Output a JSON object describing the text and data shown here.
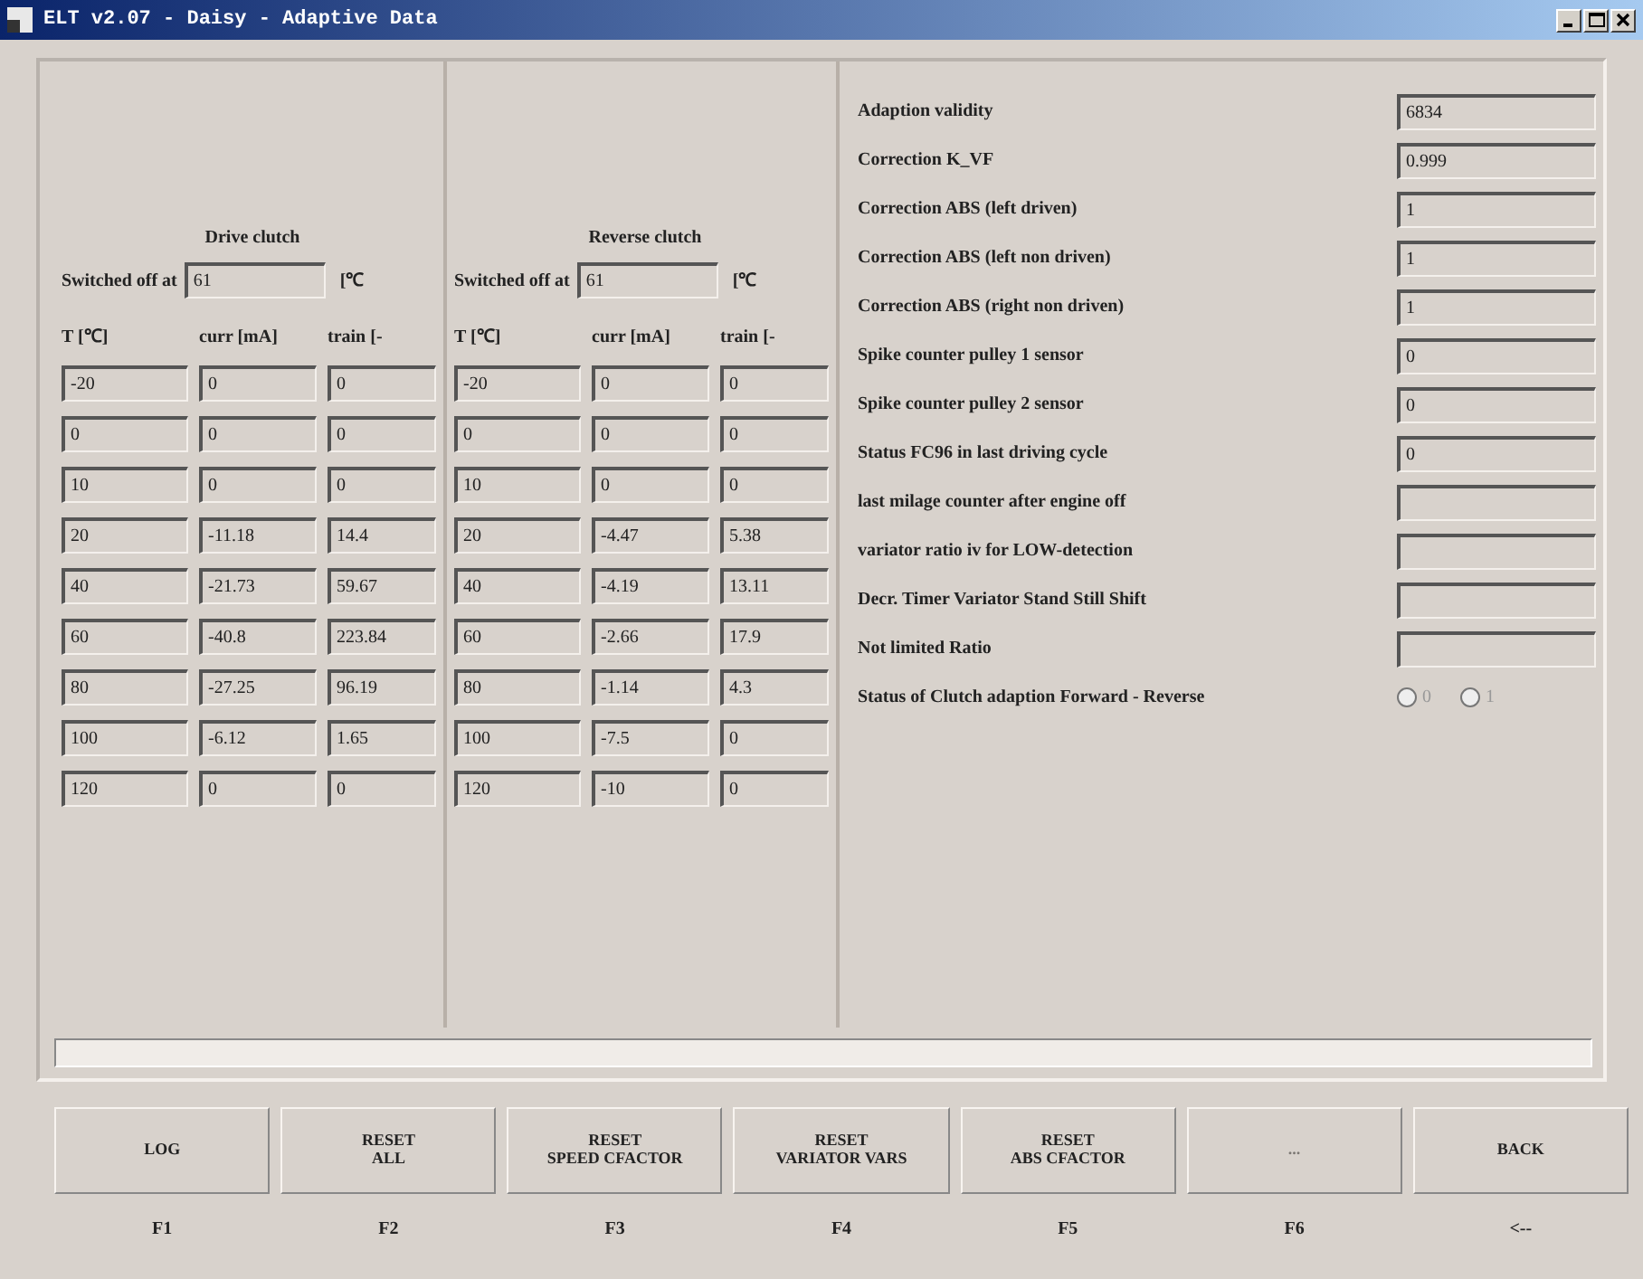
{
  "window": {
    "title": "ELT v2.07 - Daisy - Adaptive Data"
  },
  "clutches": [
    {
      "title": "Drive clutch",
      "switched_label": "Switched off at",
      "switched_value": "61",
      "switched_unit": "[℃",
      "columns": [
        "T [℃]",
        "curr [mA]",
        "train [-"
      ],
      "rows": [
        [
          "-20",
          "0",
          "0"
        ],
        [
          "0",
          "0",
          "0"
        ],
        [
          "10",
          "0",
          "0"
        ],
        [
          "20",
          "-11.18",
          "14.4"
        ],
        [
          "40",
          "-21.73",
          "59.67"
        ],
        [
          "60",
          "-40.8",
          "223.84"
        ],
        [
          "80",
          "-27.25",
          "96.19"
        ],
        [
          "100",
          "-6.12",
          "1.65"
        ],
        [
          "120",
          "0",
          "0"
        ]
      ]
    },
    {
      "title": "Reverse clutch",
      "switched_label": "Switched off at",
      "switched_value": "61",
      "switched_unit": "[℃",
      "columns": [
        "T [℃]",
        "curr [mA]",
        "train [-"
      ],
      "rows": [
        [
          "-20",
          "0",
          "0"
        ],
        [
          "0",
          "0",
          "0"
        ],
        [
          "10",
          "0",
          "0"
        ],
        [
          "20",
          "-4.47",
          "5.38"
        ],
        [
          "40",
          "-4.19",
          "13.11"
        ],
        [
          "60",
          "-2.66",
          "17.9"
        ],
        [
          "80",
          "-1.14",
          "4.3"
        ],
        [
          "100",
          "-7.5",
          "0"
        ],
        [
          "120",
          "-10",
          "0"
        ]
      ]
    }
  ],
  "parameters": [
    {
      "label": "Adaption validity",
      "value": "6834"
    },
    {
      "label": "Correction K_VF",
      "value": "0.999"
    },
    {
      "label": "Correction ABS (left driven)",
      "value": "1"
    },
    {
      "label": "Correction ABS (left non driven)",
      "value": "1"
    },
    {
      "label": "Correction ABS (right non driven)",
      "value": "1"
    },
    {
      "label": "Spike counter pulley 1 sensor",
      "value": "0"
    },
    {
      "label": "Spike counter pulley 2 sensor",
      "value": "0"
    },
    {
      "label": "Status FC96 in last driving cycle",
      "value": "0"
    },
    {
      "label": "last milage counter after engine off"
    },
    {
      "label": "variator ratio iv for LOW-detection"
    },
    {
      "label": "Decr. Timer Variator Stand Still Shift"
    },
    {
      "label": "Not limited Ratio"
    }
  ],
  "clutch_status": {
    "label": "Status of Clutch adaption Forward - Reverse",
    "options": [
      {
        "label": "0",
        "selected": false
      },
      {
        "label": "1",
        "selected": false
      }
    ]
  },
  "buttons": [
    {
      "label": "LOG",
      "key": "F1",
      "disabled": false
    },
    {
      "label": "RESET\nALL",
      "key": "F2",
      "disabled": false
    },
    {
      "label": "RESET\nSPEED CFACTOR",
      "key": "F3",
      "disabled": false
    },
    {
      "label": "RESET\nVARIATOR VARS",
      "key": "F4",
      "disabled": false
    },
    {
      "label": "RESET\nABS CFACTOR",
      "key": "F5",
      "disabled": false
    },
    {
      "label": "...",
      "key": "F6",
      "disabled": true
    },
    {
      "label": "BACK",
      "key": "<--",
      "disabled": false
    }
  ]
}
